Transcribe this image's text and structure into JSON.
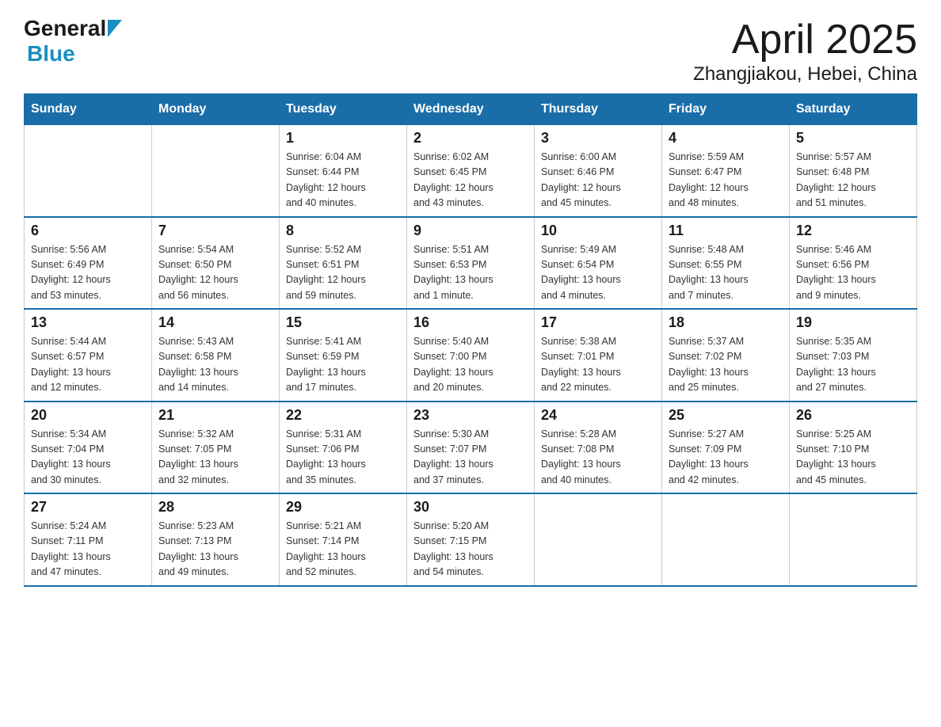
{
  "logo": {
    "general": "General",
    "blue": "Blue"
  },
  "title": "April 2025",
  "subtitle": "Zhangjiakou, Hebei, China",
  "weekdays": [
    "Sunday",
    "Monday",
    "Tuesday",
    "Wednesday",
    "Thursday",
    "Friday",
    "Saturday"
  ],
  "weeks": [
    [
      {
        "day": "",
        "info": ""
      },
      {
        "day": "",
        "info": ""
      },
      {
        "day": "1",
        "info": "Sunrise: 6:04 AM\nSunset: 6:44 PM\nDaylight: 12 hours\nand 40 minutes."
      },
      {
        "day": "2",
        "info": "Sunrise: 6:02 AM\nSunset: 6:45 PM\nDaylight: 12 hours\nand 43 minutes."
      },
      {
        "day": "3",
        "info": "Sunrise: 6:00 AM\nSunset: 6:46 PM\nDaylight: 12 hours\nand 45 minutes."
      },
      {
        "day": "4",
        "info": "Sunrise: 5:59 AM\nSunset: 6:47 PM\nDaylight: 12 hours\nand 48 minutes."
      },
      {
        "day": "5",
        "info": "Sunrise: 5:57 AM\nSunset: 6:48 PM\nDaylight: 12 hours\nand 51 minutes."
      }
    ],
    [
      {
        "day": "6",
        "info": "Sunrise: 5:56 AM\nSunset: 6:49 PM\nDaylight: 12 hours\nand 53 minutes."
      },
      {
        "day": "7",
        "info": "Sunrise: 5:54 AM\nSunset: 6:50 PM\nDaylight: 12 hours\nand 56 minutes."
      },
      {
        "day": "8",
        "info": "Sunrise: 5:52 AM\nSunset: 6:51 PM\nDaylight: 12 hours\nand 59 minutes."
      },
      {
        "day": "9",
        "info": "Sunrise: 5:51 AM\nSunset: 6:53 PM\nDaylight: 13 hours\nand 1 minute."
      },
      {
        "day": "10",
        "info": "Sunrise: 5:49 AM\nSunset: 6:54 PM\nDaylight: 13 hours\nand 4 minutes."
      },
      {
        "day": "11",
        "info": "Sunrise: 5:48 AM\nSunset: 6:55 PM\nDaylight: 13 hours\nand 7 minutes."
      },
      {
        "day": "12",
        "info": "Sunrise: 5:46 AM\nSunset: 6:56 PM\nDaylight: 13 hours\nand 9 minutes."
      }
    ],
    [
      {
        "day": "13",
        "info": "Sunrise: 5:44 AM\nSunset: 6:57 PM\nDaylight: 13 hours\nand 12 minutes."
      },
      {
        "day": "14",
        "info": "Sunrise: 5:43 AM\nSunset: 6:58 PM\nDaylight: 13 hours\nand 14 minutes."
      },
      {
        "day": "15",
        "info": "Sunrise: 5:41 AM\nSunset: 6:59 PM\nDaylight: 13 hours\nand 17 minutes."
      },
      {
        "day": "16",
        "info": "Sunrise: 5:40 AM\nSunset: 7:00 PM\nDaylight: 13 hours\nand 20 minutes."
      },
      {
        "day": "17",
        "info": "Sunrise: 5:38 AM\nSunset: 7:01 PM\nDaylight: 13 hours\nand 22 minutes."
      },
      {
        "day": "18",
        "info": "Sunrise: 5:37 AM\nSunset: 7:02 PM\nDaylight: 13 hours\nand 25 minutes."
      },
      {
        "day": "19",
        "info": "Sunrise: 5:35 AM\nSunset: 7:03 PM\nDaylight: 13 hours\nand 27 minutes."
      }
    ],
    [
      {
        "day": "20",
        "info": "Sunrise: 5:34 AM\nSunset: 7:04 PM\nDaylight: 13 hours\nand 30 minutes."
      },
      {
        "day": "21",
        "info": "Sunrise: 5:32 AM\nSunset: 7:05 PM\nDaylight: 13 hours\nand 32 minutes."
      },
      {
        "day": "22",
        "info": "Sunrise: 5:31 AM\nSunset: 7:06 PM\nDaylight: 13 hours\nand 35 minutes."
      },
      {
        "day": "23",
        "info": "Sunrise: 5:30 AM\nSunset: 7:07 PM\nDaylight: 13 hours\nand 37 minutes."
      },
      {
        "day": "24",
        "info": "Sunrise: 5:28 AM\nSunset: 7:08 PM\nDaylight: 13 hours\nand 40 minutes."
      },
      {
        "day": "25",
        "info": "Sunrise: 5:27 AM\nSunset: 7:09 PM\nDaylight: 13 hours\nand 42 minutes."
      },
      {
        "day": "26",
        "info": "Sunrise: 5:25 AM\nSunset: 7:10 PM\nDaylight: 13 hours\nand 45 minutes."
      }
    ],
    [
      {
        "day": "27",
        "info": "Sunrise: 5:24 AM\nSunset: 7:11 PM\nDaylight: 13 hours\nand 47 minutes."
      },
      {
        "day": "28",
        "info": "Sunrise: 5:23 AM\nSunset: 7:13 PM\nDaylight: 13 hours\nand 49 minutes."
      },
      {
        "day": "29",
        "info": "Sunrise: 5:21 AM\nSunset: 7:14 PM\nDaylight: 13 hours\nand 52 minutes."
      },
      {
        "day": "30",
        "info": "Sunrise: 5:20 AM\nSunset: 7:15 PM\nDaylight: 13 hours\nand 54 minutes."
      },
      {
        "day": "",
        "info": ""
      },
      {
        "day": "",
        "info": ""
      },
      {
        "day": "",
        "info": ""
      }
    ]
  ]
}
